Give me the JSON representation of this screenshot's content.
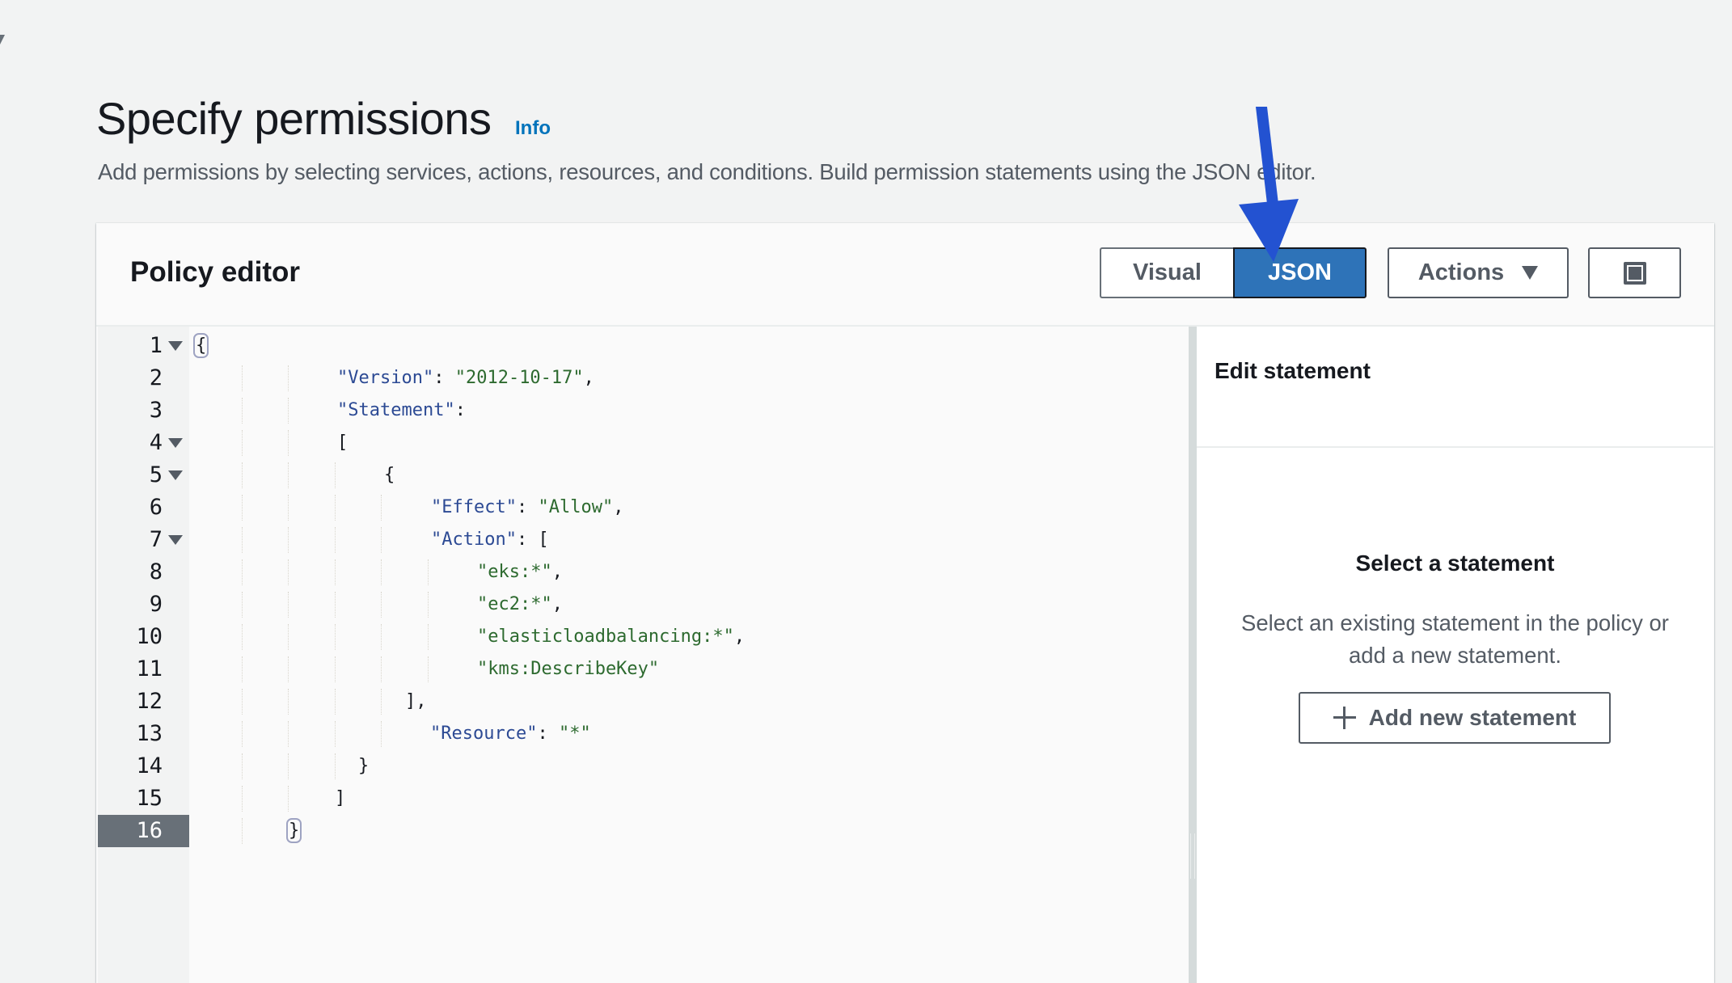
{
  "page": {
    "title": "Specify permissions",
    "info_link": "Info",
    "description": "Add permissions by selecting services, actions, resources, and conditions. Build permission statements using the JSON editor."
  },
  "policy_editor": {
    "title": "Policy editor",
    "mode_toggle": {
      "options": [
        "Visual",
        "JSON"
      ],
      "selected": "JSON"
    },
    "actions_label": "Actions",
    "fullscreen_icon": "fullscreen-icon",
    "active_line": 16,
    "lines": [
      {
        "n": "1",
        "fold": true,
        "tokens": [
          {
            "t": "{",
            "c": "punc",
            "match": true
          }
        ]
      },
      {
        "n": "2",
        "fold": false,
        "tokens": [
          {
            "t": "\"Version\"",
            "c": "key"
          },
          {
            "t": ": ",
            "c": "punc"
          },
          {
            "t": "\"2012-10-17\"",
            "c": "str"
          },
          {
            "t": ",",
            "c": "punc"
          }
        ]
      },
      {
        "n": "3",
        "fold": false,
        "tokens": [
          {
            "t": "\"Statement\"",
            "c": "key"
          },
          {
            "t": ":",
            "c": "punc"
          }
        ]
      },
      {
        "n": "4",
        "fold": true,
        "tokens": [
          {
            "t": "[",
            "c": "punc"
          }
        ]
      },
      {
        "n": "5",
        "fold": true,
        "tokens": [
          {
            "t": "{",
            "c": "punc"
          }
        ]
      },
      {
        "n": "6",
        "fold": false,
        "tokens": [
          {
            "t": "\"Effect\"",
            "c": "key"
          },
          {
            "t": ": ",
            "c": "punc"
          },
          {
            "t": "\"Allow\"",
            "c": "str"
          },
          {
            "t": ",",
            "c": "punc"
          }
        ]
      },
      {
        "n": "7",
        "fold": true,
        "tokens": [
          {
            "t": "\"Action\"",
            "c": "key"
          },
          {
            "t": ": [",
            "c": "punc"
          }
        ]
      },
      {
        "n": "8",
        "fold": false,
        "tokens": [
          {
            "t": "\"eks:*\"",
            "c": "str"
          },
          {
            "t": ",",
            "c": "punc"
          }
        ]
      },
      {
        "n": "9",
        "fold": false,
        "tokens": [
          {
            "t": "\"ec2:*\"",
            "c": "str"
          },
          {
            "t": ",",
            "c": "punc"
          }
        ]
      },
      {
        "n": "10",
        "fold": false,
        "tokens": [
          {
            "t": "\"elasticloadbalancing:*\"",
            "c": "str"
          },
          {
            "t": ",",
            "c": "punc"
          }
        ]
      },
      {
        "n": "11",
        "fold": false,
        "tokens": [
          {
            "t": "\"kms:DescribeKey\"",
            "c": "str"
          }
        ]
      },
      {
        "n": "12",
        "fold": false,
        "tokens": [
          {
            "t": "],",
            "c": "punc"
          }
        ]
      },
      {
        "n": "13",
        "fold": false,
        "tokens": [
          {
            "t": "\"Resource\"",
            "c": "key"
          },
          {
            "t": ": ",
            "c": "punc"
          },
          {
            "t": "\"*\"",
            "c": "str"
          }
        ]
      },
      {
        "n": "14",
        "fold": false,
        "tokens": [
          {
            "t": "}",
            "c": "punc"
          }
        ]
      },
      {
        "n": "15",
        "fold": false,
        "tokens": [
          {
            "t": "]",
            "c": "punc"
          }
        ]
      },
      {
        "n": "16",
        "fold": false,
        "tokens": [
          {
            "t": "}",
            "c": "punc",
            "match": true
          }
        ]
      }
    ]
  },
  "edit_statement": {
    "title": "Edit statement",
    "empty_title": "Select a statement",
    "empty_description": "Select an existing statement in the policy or add a new statement.",
    "add_button_label": "Add new statement"
  },
  "annotation": {
    "type": "arrow",
    "color": "#2352d1",
    "points_to": "JSON"
  },
  "colors": {
    "accent": "#2e73b8",
    "link": "#0073bb",
    "json_key": "#2c4a94",
    "json_string": "#2d6a2f",
    "active_line_gutter": "#687078"
  }
}
